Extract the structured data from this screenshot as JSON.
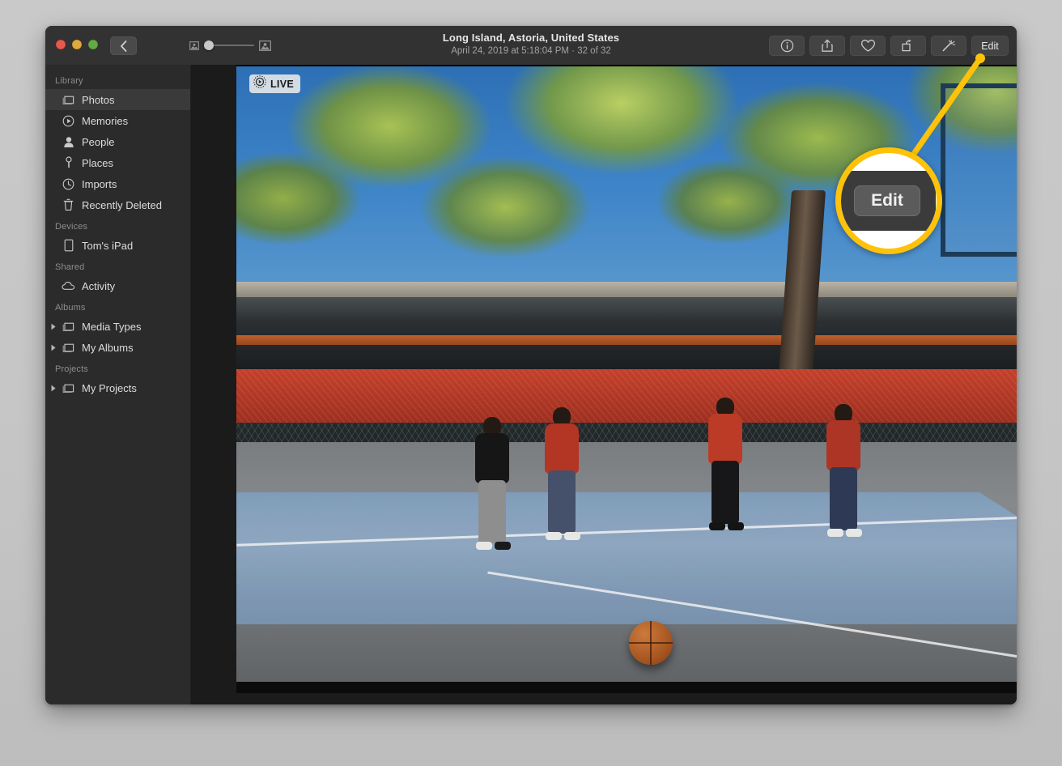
{
  "app": {
    "name": "Photos",
    "title": "Long Island, Astoria, United States",
    "subtitle": "April 24, 2019 at 5:18:04 PM  ·  32 of 32"
  },
  "window_controls": {
    "close": "close-button",
    "minimize": "minimize-button",
    "zoom": "zoom-button",
    "close_color": "#e8584e",
    "minimize_color": "#dfaa3c",
    "zoom_color": "#63a944"
  },
  "toolbar": {
    "back_label": "Back",
    "thumbnail_slider": {
      "small_icon": "small-photo-icon",
      "large_icon": "large-photo-icon",
      "value": 0
    },
    "buttons": [
      {
        "name": "info-button",
        "icon": "info-icon",
        "label": ""
      },
      {
        "name": "share-button",
        "icon": "share-icon",
        "label": ""
      },
      {
        "name": "favorite-button",
        "icon": "heart-icon",
        "label": ""
      },
      {
        "name": "rotate-button",
        "icon": "rotate-icon",
        "label": ""
      },
      {
        "name": "auto-enhance-button",
        "icon": "magic-wand-icon",
        "label": ""
      },
      {
        "name": "edit-button",
        "icon": "",
        "label": "Edit"
      }
    ]
  },
  "sidebar": {
    "sections": [
      {
        "header": "Library",
        "items": [
          {
            "label": "Photos",
            "icon": "photos-icon",
            "selected": true,
            "disclosure": false
          },
          {
            "label": "Memories",
            "icon": "memories-icon",
            "selected": false,
            "disclosure": false
          },
          {
            "label": "People",
            "icon": "people-icon",
            "selected": false,
            "disclosure": false
          },
          {
            "label": "Places",
            "icon": "places-pin-icon",
            "selected": false,
            "disclosure": false
          },
          {
            "label": "Imports",
            "icon": "imports-clock-icon",
            "selected": false,
            "disclosure": false
          },
          {
            "label": "Recently Deleted",
            "icon": "trash-icon",
            "selected": false,
            "disclosure": false
          }
        ]
      },
      {
        "header": "Devices",
        "items": [
          {
            "label": "Tom's iPad",
            "icon": "ipad-icon",
            "selected": false,
            "disclosure": false
          }
        ]
      },
      {
        "header": "Shared",
        "items": [
          {
            "label": "Activity",
            "icon": "cloud-icon",
            "selected": false,
            "disclosure": false
          }
        ]
      },
      {
        "header": "Albums",
        "items": [
          {
            "label": "Media Types",
            "icon": "album-icon",
            "selected": false,
            "disclosure": true
          },
          {
            "label": "My Albums",
            "icon": "album-icon",
            "selected": false,
            "disclosure": true
          }
        ]
      },
      {
        "header": "Projects",
        "items": [
          {
            "label": "My Projects",
            "icon": "album-icon",
            "selected": false,
            "disclosure": true
          }
        ]
      }
    ]
  },
  "photo": {
    "live_badge": "LIVE",
    "live_icon": "live-photo-icon",
    "description": "Four young men on an outdoor basketball court with a basketball, elevated train structure and trees behind"
  },
  "callout": {
    "highlight_color": "#ffc20a",
    "magnified_label": "Edit",
    "target": "edit-button"
  }
}
